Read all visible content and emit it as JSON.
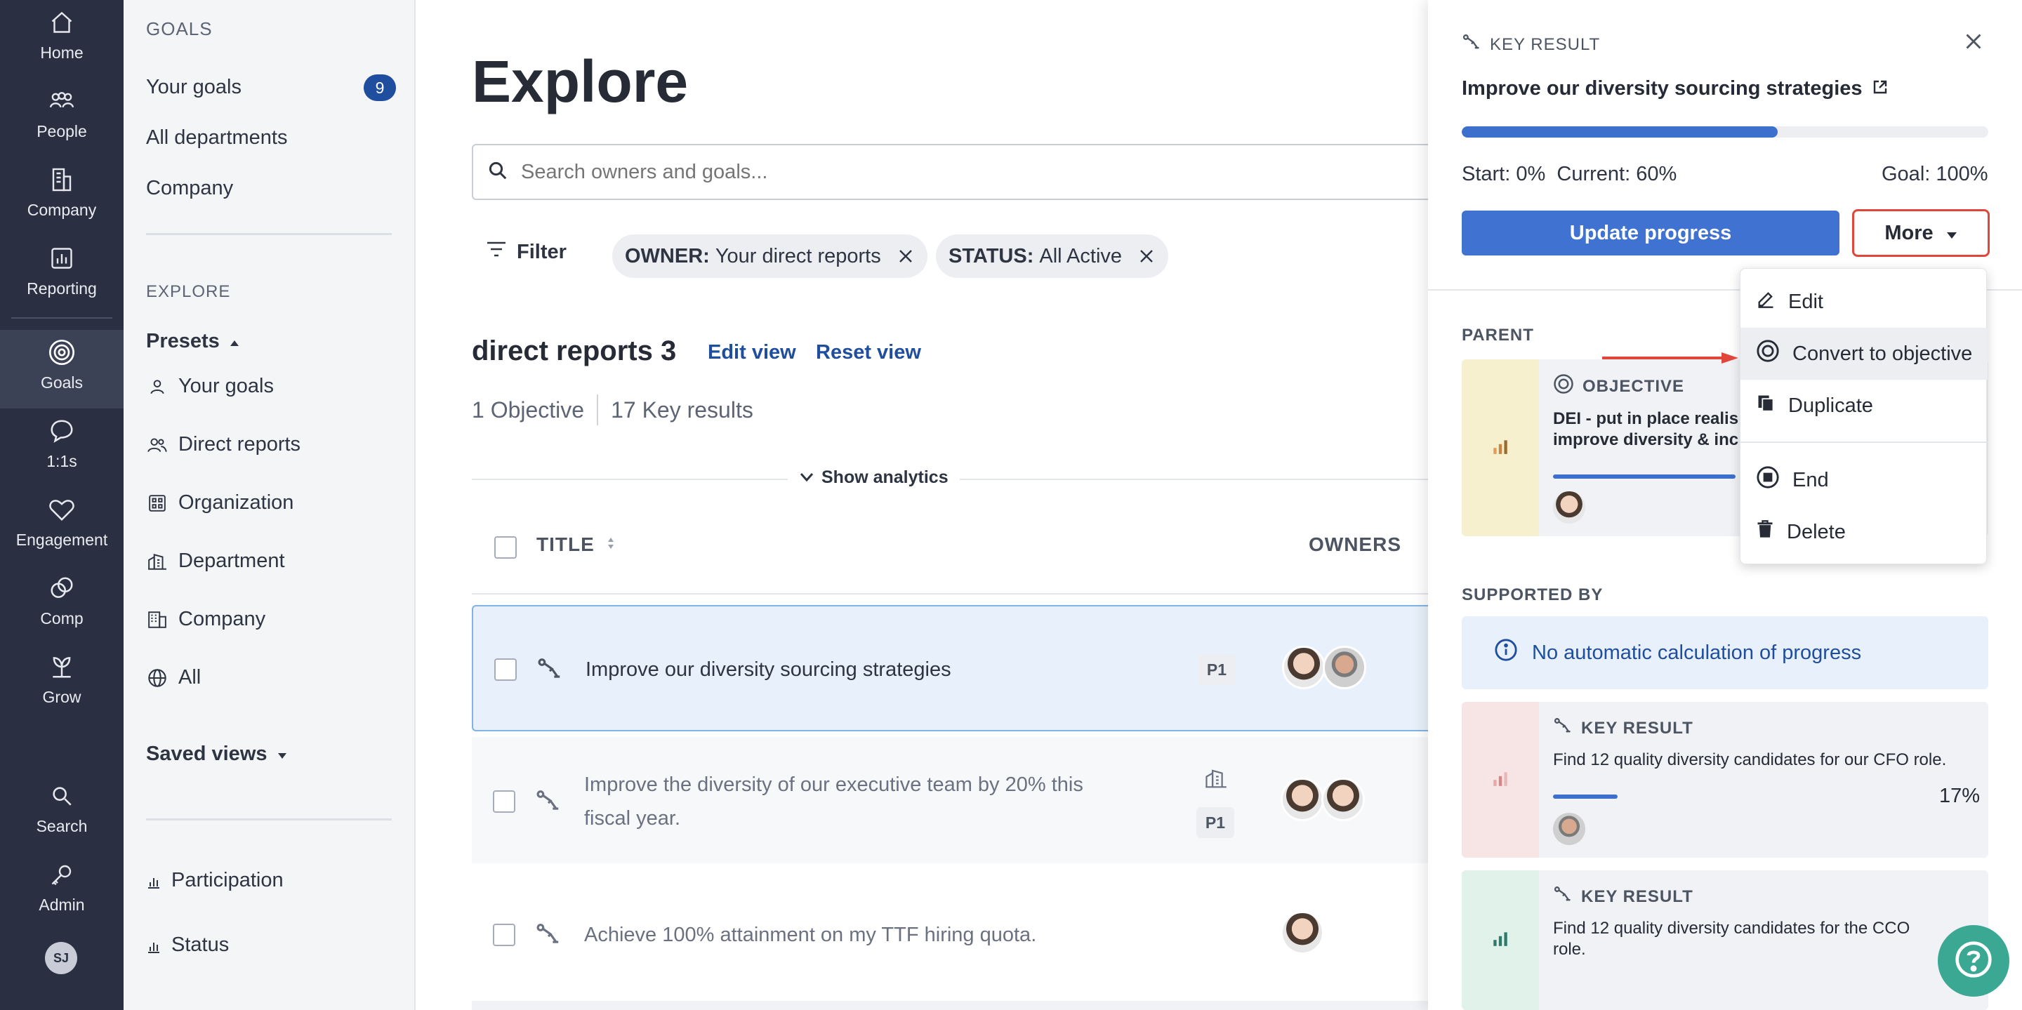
{
  "rail": {
    "items": [
      {
        "label": "Home",
        "icon": "home-icon"
      },
      {
        "label": "People",
        "icon": "people-icon"
      },
      {
        "label": "Company",
        "icon": "building-icon"
      },
      {
        "label": "Reporting",
        "icon": "chart-icon"
      },
      {
        "label": "Goals",
        "icon": "target-icon"
      },
      {
        "label": "1:1s",
        "icon": "chat-icon"
      },
      {
        "label": "Engagement",
        "icon": "heart-icon"
      },
      {
        "label": "Comp",
        "icon": "coins-icon"
      },
      {
        "label": "Grow",
        "icon": "sprout-icon"
      },
      {
        "label": "Search",
        "icon": "search-icon"
      },
      {
        "label": "Admin",
        "icon": "key-icon"
      }
    ],
    "avatar_initials": "SJ"
  },
  "sidebar": {
    "section_goals": "GOALS",
    "your_goals": "Your goals",
    "your_goals_count": "9",
    "all_departments": "All departments",
    "company": "Company",
    "section_explore": "EXPLORE",
    "presets": "Presets",
    "presets_items": [
      "Your goals",
      "Direct reports",
      "Organization",
      "Department",
      "Company",
      "All"
    ],
    "saved_views": "Saved views",
    "participation": "Participation",
    "status": "Status"
  },
  "main": {
    "title": "Explore",
    "search_placeholder": "Search owners and goals...",
    "filter_label": "Filter",
    "chips": [
      {
        "key": "OWNER:",
        "value": "Your direct reports"
      },
      {
        "key": "STATUS:",
        "value": "All Active"
      }
    ],
    "view_title": "direct reports 3",
    "edit_view": "Edit view",
    "reset_view": "Reset view",
    "count_objectives": "1 Objective",
    "count_krs": "17 Key results",
    "show_analytics": "Show analytics",
    "col_title": "TITLE",
    "col_owners": "OWNERS",
    "rows": [
      {
        "title": "Improve our diversity sourcing strategies",
        "priority": "P1"
      },
      {
        "title_line1": "Improve the diversity of our executive team by 20% this",
        "title_line2": "fiscal year.",
        "priority": "P1"
      },
      {
        "title": "Achieve 100% attainment on my TTF hiring quota."
      }
    ]
  },
  "panel": {
    "kicker": "KEY RESULT",
    "title": "Improve our diversity sourcing strategies",
    "progress_current": 60,
    "stats": "Start: 0%  Current: 60%",
    "goal": "Goal: 100%",
    "update_button": "Update progress",
    "more_button": "More",
    "parent_label": "PARENT",
    "parent_kicker": "OBJECTIVE",
    "parent_text_line1": "DEI - put in place realis",
    "parent_text_line2": "improve diversity & inc",
    "supported_label": "SUPPORTED BY",
    "info_text": "No automatic calculation of progress",
    "cards": [
      {
        "kicker": "KEY RESULT",
        "line1": "Find 12 quality diversity candidates for our CFO role.",
        "line2": "",
        "pct": "17%",
        "progress": 17
      },
      {
        "kicker": "KEY RESULT",
        "line1": "Find 12 quality diversity candidates for the CCO",
        "line2": "role.",
        "pct": "",
        "progress": 0
      }
    ]
  },
  "menu": {
    "items": [
      {
        "label": "Edit",
        "icon": "pencil-icon"
      },
      {
        "label": "Convert to objective",
        "icon": "target-icon"
      },
      {
        "label": "Duplicate",
        "icon": "copy-icon"
      },
      {
        "label": "End",
        "icon": "stop-icon"
      },
      {
        "label": "Delete",
        "icon": "trash-icon"
      }
    ]
  },
  "colors": {
    "rail_bg": "#2a3042",
    "accent_blue": "#3f72d1",
    "highlight_red": "#e0473a",
    "help_green": "#3aa893"
  }
}
